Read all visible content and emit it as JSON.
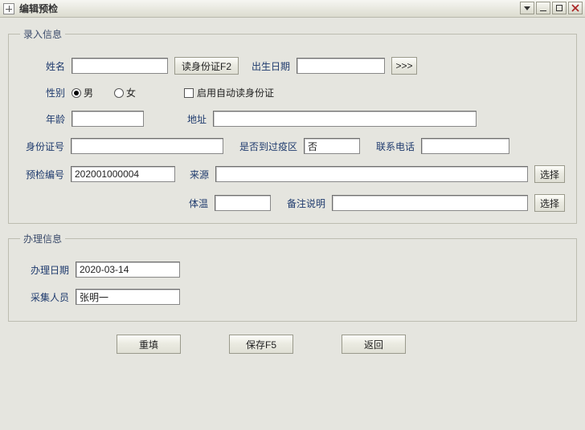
{
  "window": {
    "title": "编辑预检"
  },
  "group_entry": {
    "legend": "录入信息",
    "name_label": "姓名",
    "name_value": "",
    "read_id_btn": "读身份证F2",
    "birth_label": "出生日期",
    "birth_value": "",
    "birth_more_btn": ">>>",
    "gender_label": "性别",
    "gender_male": "男",
    "gender_female": "女",
    "gender_value": "male",
    "auto_read_label": "启用自动读身份证",
    "auto_read_checked": false,
    "age_label": "年龄",
    "age_value": "",
    "address_label": "地址",
    "address_value": "",
    "idnum_label": "身份证号",
    "idnum_value": "",
    "epidemic_label": "是否到过疫区",
    "epidemic_value": "否",
    "phone_label": "联系电话",
    "phone_value": "",
    "precheck_label": "预检编号",
    "precheck_value": "202001000004",
    "source_label": "来源",
    "source_value": "",
    "source_select_btn": "选择",
    "temperature_label": "体温",
    "temperature_value": "",
    "remark_label": "备注说明",
    "remark_value": "",
    "remark_select_btn": "选择"
  },
  "group_process": {
    "legend": "办理信息",
    "date_label": "办理日期",
    "date_value": "2020-03-14",
    "collector_label": "采集人员",
    "collector_value": "张明一"
  },
  "footer": {
    "reset": "重填",
    "save": "保存F5",
    "back": "返回"
  }
}
